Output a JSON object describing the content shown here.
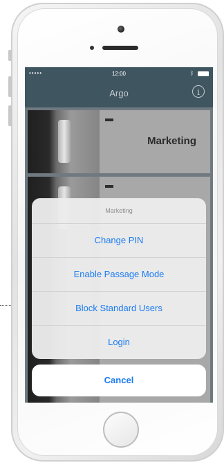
{
  "status_bar": {
    "signal": "•••••",
    "time": "12:00",
    "bluetooth": "ᛒ"
  },
  "nav": {
    "title": "Argo",
    "info_icon": "info-icon",
    "info_glyph": "i"
  },
  "locks": [
    {
      "name": "Marketing"
    },
    {
      "name": ""
    }
  ],
  "action_sheet": {
    "title": "Marketing",
    "actions": [
      {
        "label": "Change PIN"
      },
      {
        "label": "Enable Passage Mode"
      },
      {
        "label": "Block Standard Users"
      },
      {
        "label": "Login"
      }
    ],
    "cancel_label": "Cancel"
  },
  "colors": {
    "nav_bar": "#3f5560",
    "action_text": "#1a7bf0"
  }
}
